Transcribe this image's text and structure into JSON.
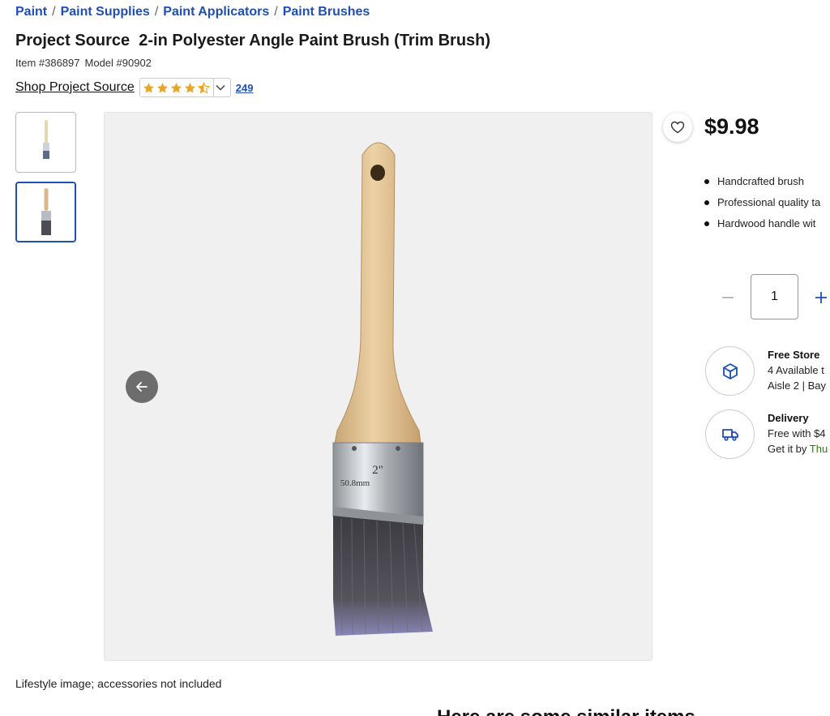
{
  "breadcrumb": [
    {
      "label": "Paint"
    },
    {
      "label": "Paint Supplies"
    },
    {
      "label": "Paint Applicators"
    },
    {
      "label": "Paint Brushes"
    }
  ],
  "breadcrumb_separator": "/",
  "product": {
    "title": "Project Source  2-in Polyester Angle Paint Brush (Trim Brush)",
    "item_number": "Item #386897",
    "model_number": "Model #90902",
    "shop_link": "Shop Project Source",
    "rating": 4.5,
    "review_count": "249",
    "price": "$9.98",
    "bullets": [
      "Handcrafted brush",
      "Professional quality ta",
      "Hardwood handle wit"
    ]
  },
  "gallery": {
    "thumbnail_count": 2,
    "selected_thumbnail": 2,
    "brush_size_label": "2\"",
    "brush_size_mm": "50.8mm",
    "caption": "Lifestyle image; accessories not included"
  },
  "quantity": {
    "value": "1"
  },
  "fulfillment": {
    "pickup": {
      "title": "Free Store",
      "availability": "4 Available t",
      "location": "Aisle 2 | Bay"
    },
    "delivery": {
      "title": "Delivery",
      "line1": "Free with $4",
      "line2_prefix": "Get it by ",
      "line2_date": "Thu"
    }
  },
  "similar": {
    "heading": "Here are some similar items"
  },
  "colors": {
    "link": "#1f4fb3",
    "star": "#e9a626",
    "availability": "#2f7d10",
    "icon_blue": "#1f4fb3"
  },
  "icons": [
    "star-icon",
    "chevron-down-icon",
    "arrow-left-icon",
    "heart-icon",
    "minus-icon",
    "plus-icon",
    "pickup-box-icon",
    "delivery-truck-icon"
  ]
}
